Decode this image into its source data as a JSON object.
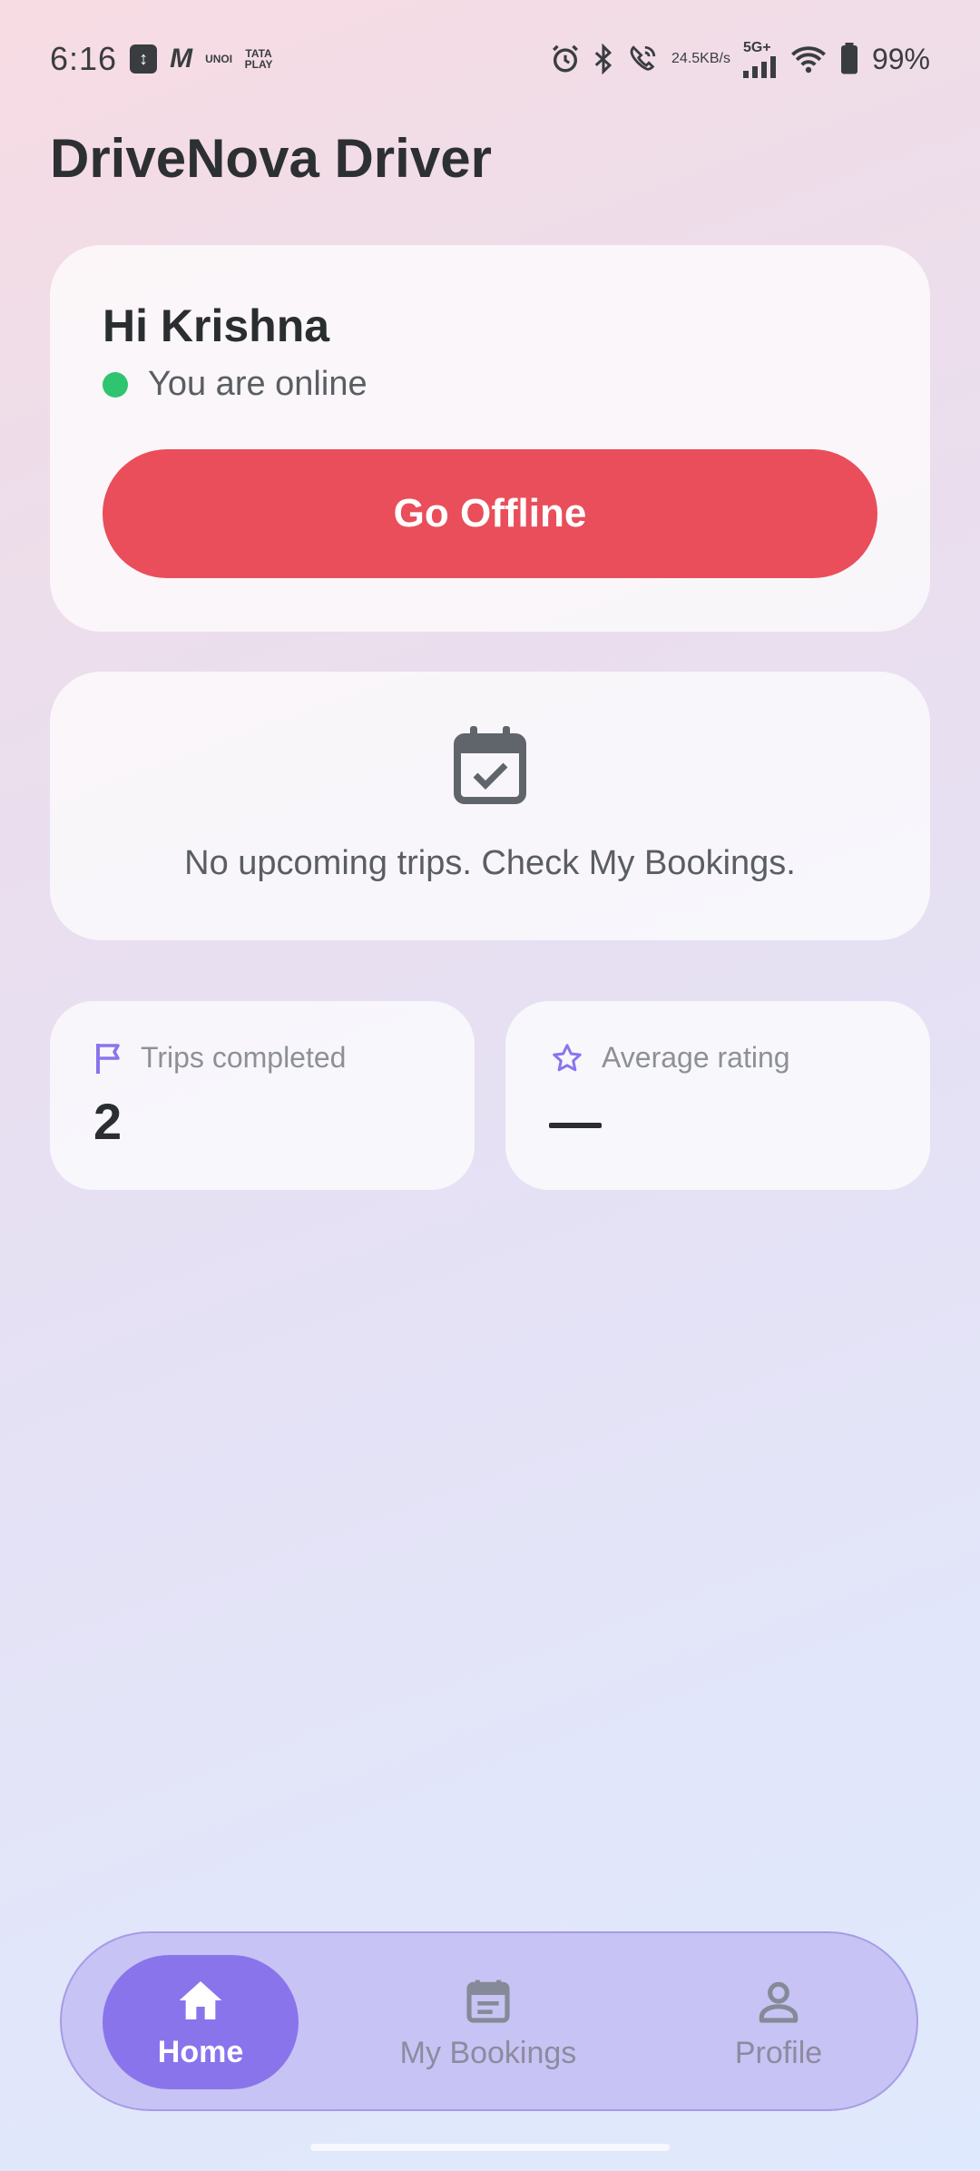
{
  "status_bar": {
    "time": "6:16",
    "left_icons": [
      "usb-icon",
      "m-app-icon",
      "unoi-app-icon",
      "tata-play-icon"
    ],
    "m_label": "M",
    "unoi_label": "UNOI",
    "tata_play_label": "TATA PLAY",
    "network_speed": "24.5",
    "network_speed_unit": "KB/s",
    "network_type": "5G+",
    "battery": "99%",
    "right_icons": [
      "alarm-icon",
      "bluetooth-icon",
      "wifi-call-icon",
      "signal-icon",
      "wifi-icon",
      "battery-icon"
    ]
  },
  "header": {
    "title": "DriveNova Driver"
  },
  "greeting_card": {
    "greeting": "Hi Krishna",
    "status_text": "You are online",
    "status_color": "#2fc46f",
    "button_label": "Go Offline",
    "button_color": "#e94e5a"
  },
  "trips_card": {
    "icon": "calendar-check-icon",
    "message": "No upcoming trips. Check My Bookings."
  },
  "stats": {
    "trips_completed": {
      "icon": "flag-icon",
      "label": "Trips completed",
      "value": "2"
    },
    "average_rating": {
      "icon": "star-icon",
      "label": "Average rating",
      "value": "—"
    }
  },
  "bottom_nav": {
    "items": [
      {
        "label": "Home",
        "icon": "home-icon",
        "active": true
      },
      {
        "label": "My Bookings",
        "icon": "calendar-list-icon",
        "active": false
      },
      {
        "label": "Profile",
        "icon": "person-icon",
        "active": false
      }
    ],
    "accent": "#8a74ec"
  }
}
